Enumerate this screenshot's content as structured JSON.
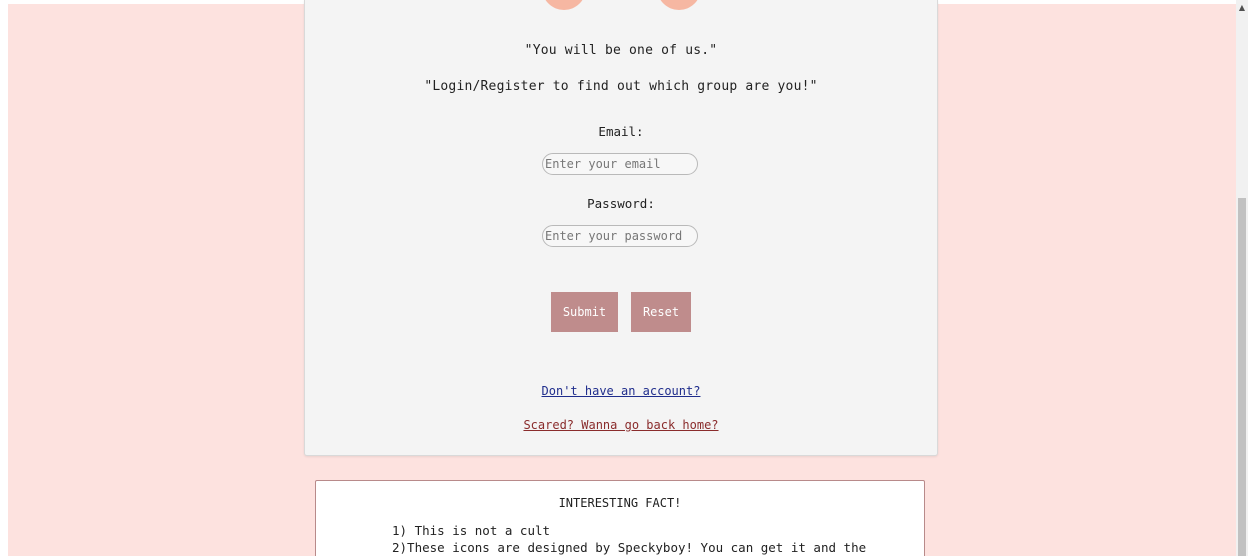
{
  "login": {
    "tagline_1": "\"You will be one of us.\"",
    "tagline_2": "\"Login/Register to find out which group are you!\"",
    "email_label": "Email:",
    "email_placeholder": "Enter your email",
    "password_label": "Password:",
    "password_placeholder": "Enter your password",
    "submit_label": "Submit",
    "reset_label": "Reset",
    "register_link": "Don't have an account?",
    "home_link": "Scared? Wanna go back home?"
  },
  "fact": {
    "title": "INTERESTING FACT!",
    "lines": [
      "1) This is not a cult",
      "2)These icons are designed by Speckyboy! You can get it and the"
    ]
  },
  "colors": {
    "page_background": "#fde2df",
    "card_background": "#f4f4f4",
    "button": "#bf8c8c",
    "circle_accent": "#f6b7a2",
    "register_link": "#1f2d8c",
    "home_link": "#8a2c2c"
  },
  "icons": {
    "scroll_up": "triangle-up-icon"
  }
}
